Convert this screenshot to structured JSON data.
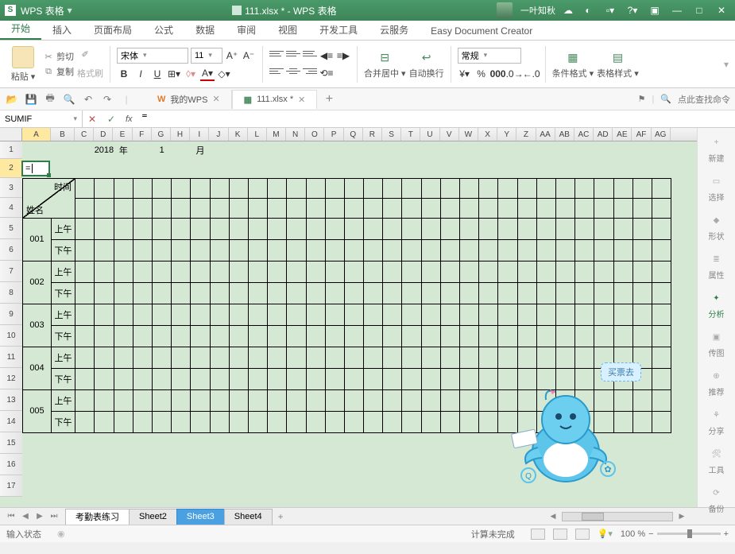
{
  "app": {
    "name": "WPS 表格",
    "doc_title": "111.xlsx * - WPS 表格",
    "user": "一叶知秋"
  },
  "menu": {
    "items": [
      "开始",
      "插入",
      "页面布局",
      "公式",
      "数据",
      "审阅",
      "视图",
      "开发工具",
      "云服务",
      "Easy Document Creator"
    ],
    "active_index": 0
  },
  "ribbon": {
    "paste": "粘贴",
    "cut": "剪切",
    "copy": "复制",
    "format_painter": "格式刷",
    "font_name": "宋体",
    "font_size": "11",
    "merge_center": "合并居中",
    "wrap": "自动换行",
    "number_format": "常规",
    "cond_fmt": "条件格式",
    "table_style": "表格样式"
  },
  "doctabs": {
    "items": [
      {
        "label": "我的WPS",
        "closable": true,
        "active": false,
        "prefix": "W"
      },
      {
        "label": "111.xlsx *",
        "closable": true,
        "active": true,
        "prefix": "▦"
      }
    ],
    "search_placeholder": "点此查找命令"
  },
  "formula_bar": {
    "name_box": "SUMIF",
    "formula": "="
  },
  "grid": {
    "columns": [
      "A",
      "B",
      "C",
      "D",
      "E",
      "F",
      "G",
      "H",
      "I",
      "J",
      "K",
      "L",
      "M",
      "N",
      "O",
      "P",
      "Q",
      "R",
      "S",
      "T",
      "U",
      "V",
      "W",
      "X",
      "Y",
      "Z",
      "AA",
      "AB",
      "AC",
      "AD",
      "AE",
      "AF",
      "AG"
    ],
    "active_col_index": 0,
    "active_row": 2,
    "active_cell_value": "=",
    "row1": {
      "year": "2018",
      "year_label": "年",
      "month": "1",
      "month_label": "月"
    },
    "header": {
      "time": "时间",
      "name": "姓名"
    },
    "rows": [
      {
        "id": "001",
        "am": "上午",
        "pm": "下午"
      },
      {
        "id": "002",
        "am": "上午",
        "pm": "下午"
      },
      {
        "id": "003",
        "am": "上午",
        "pm": "下午"
      },
      {
        "id": "004",
        "am": "上午",
        "pm": "下午"
      },
      {
        "id": "005",
        "am": "上午",
        "pm": "下午"
      }
    ]
  },
  "mascot": {
    "bubble": "买票去"
  },
  "sidepanel": {
    "items": [
      {
        "label": "新建",
        "icon": "+"
      },
      {
        "label": "选择",
        "icon": "▭"
      },
      {
        "label": "形状",
        "icon": "◆"
      },
      {
        "label": "属性",
        "icon": "≣"
      },
      {
        "label": "分析",
        "icon": "✦",
        "active": true
      },
      {
        "label": "传图",
        "icon": "▣"
      },
      {
        "label": "推荐",
        "icon": "⊕"
      },
      {
        "label": "分享",
        "icon": "⚘"
      },
      {
        "label": "工具",
        "icon": "🛠"
      },
      {
        "label": "备份",
        "icon": "⟳"
      }
    ]
  },
  "sheets": {
    "tabs": [
      "考勤表练习",
      "Sheet2",
      "Sheet3",
      "Sheet4"
    ],
    "active_index": 0,
    "selected_index": 2
  },
  "status": {
    "mode": "输入状态",
    "calc": "计算未完成",
    "zoom": "100 %"
  }
}
